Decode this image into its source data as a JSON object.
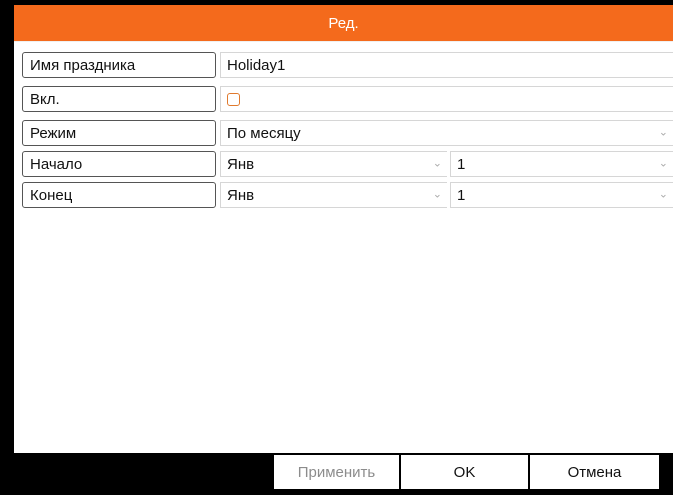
{
  "dialog": {
    "title": "Ред."
  },
  "form": {
    "holiday_name": {
      "label": "Имя праздника",
      "value": "Holiday1"
    },
    "enable": {
      "label": "Вкл.",
      "checked": false
    },
    "mode": {
      "label": "Режим",
      "value": "По месяцу"
    },
    "start": {
      "label": "Начало",
      "month": "Янв",
      "day": "1"
    },
    "end": {
      "label": "Конец",
      "month": "Янв",
      "day": "1"
    }
  },
  "buttons": {
    "apply": "Применить",
    "ok": "OK",
    "cancel": "Отмена"
  },
  "colors": {
    "accent": "#f46a1c",
    "footer": "#000000",
    "disabled_text": "#8c8c8c"
  },
  "icons": {
    "dropdown": "chevron-down-icon",
    "checkbox": "checkbox-unchecked"
  }
}
